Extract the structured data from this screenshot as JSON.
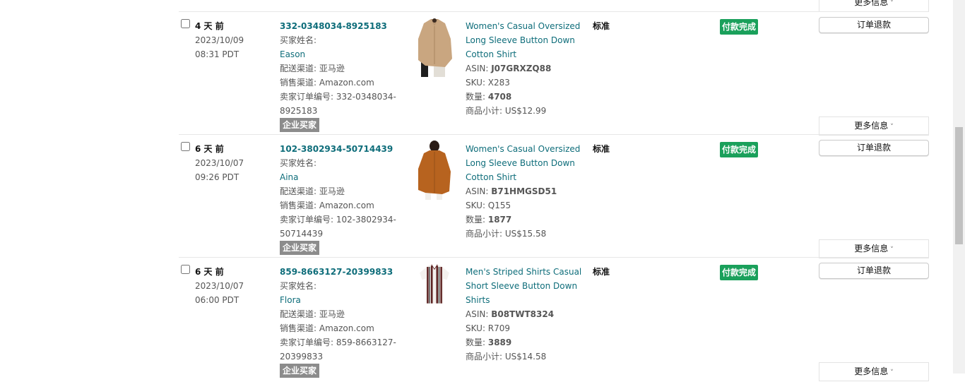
{
  "common": {
    "refund_label": "订单退款",
    "more_label": "更多信息",
    "more_arrow": "˅"
  },
  "rows": [
    {
      "age": "4 天 前",
      "date": "2023/10/09",
      "time": "08:31 PDT",
      "order_id": "332-0348034-8925183",
      "buyer_label": "买家姓名:",
      "buyer": "Eason",
      "fulfillment": "配送渠道: 亚马逊",
      "channel": "销售渠道: Amazon.com",
      "seller_order_line1": "卖家订单编号: 332-0348034-",
      "seller_order_line2": "8925183",
      "buyer_type": "企业买家",
      "title_line1": "Women's Casual Oversized",
      "title_line2": "Long Sleeve Button Down",
      "title_line3": "Cotton Shirt",
      "asin_label": "ASIN: ",
      "asin": "J07GRXZQ88",
      "sku": "SKU: X283",
      "qty_label": "数量: ",
      "qty": "4708",
      "subtotal": "商品小计: US$12.99",
      "shipping": "标准",
      "status": "付款完成",
      "image": "beige-shirt"
    },
    {
      "age": "6 天 前",
      "date": "2023/10/07",
      "time": "09:26 PDT",
      "order_id": "102-3802934-50714439",
      "buyer_label": "买家姓名:",
      "buyer": "Aina",
      "fulfillment": "配送渠道: 亚马逊",
      "channel": "销售渠道: Amazon.com",
      "seller_order_line1": "卖家订单编号: 102-3802934-",
      "seller_order_line2": "50714439",
      "buyer_type": "企业买家",
      "title_line1": "Women's Casual Oversized",
      "title_line2": "Long Sleeve Button Down",
      "title_line3": "Cotton Shirt",
      "asin_label": "ASIN: ",
      "asin": "B71HMGSD51",
      "sku": "SKU: Q155",
      "qty_label": "数量: ",
      "qty": "1877",
      "subtotal": "商品小计: US$15.58",
      "shipping": "标准",
      "status": "付款完成",
      "image": "brown-shirt"
    },
    {
      "age": "6 天 前",
      "date": "2023/10/07",
      "time": "06:00 PDT",
      "order_id": "859-8663127-20399833",
      "buyer_label": "买家姓名:",
      "buyer": "Flora",
      "fulfillment": "配送渠道: 亚马逊",
      "channel": "销售渠道: Amazon.com",
      "seller_order_line1": "卖家订单编号: 859-8663127-",
      "seller_order_line2": "20399833",
      "buyer_type": "企业买家",
      "title_line1": "Men's Striped Shirts Casual",
      "title_line2": "Short Sleeve Button Down",
      "title_line3": "Shirts",
      "asin_label": "ASIN: ",
      "asin": "B08TWT8324",
      "sku": "SKU: R709",
      "qty_label": "数量: ",
      "qty": "3889",
      "subtotal": "商品小计: US$14.58",
      "shipping": "标准",
      "status": "付款完成",
      "image": "striped-shirt"
    }
  ]
}
